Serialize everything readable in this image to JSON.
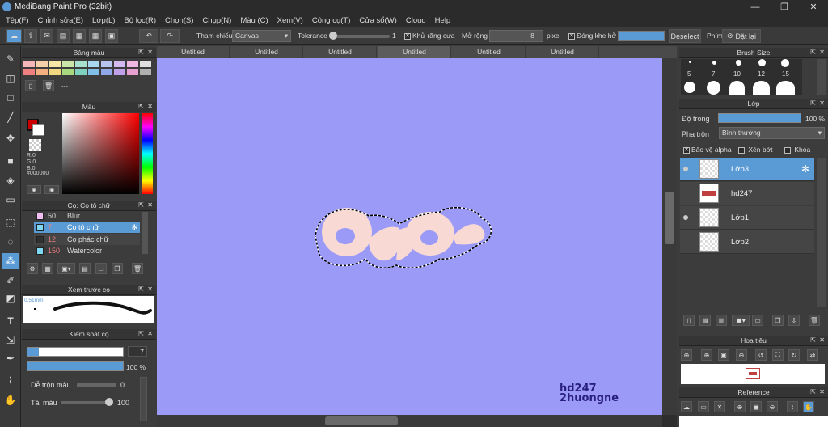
{
  "app": {
    "title": "MediBang Paint Pro (32bit)"
  },
  "window": {
    "minimize": "—",
    "maximize": "❐",
    "close": "✕"
  },
  "menu": [
    "Tệp(F)",
    "Chỉnh sửa(E)",
    "Lớp(L)",
    "Bộ lọc(R)",
    "Chọn(S)",
    "Chụp(N)",
    "Màu (C)",
    "Xem(V)",
    "Công cụ(T)",
    "Cửa sổ(W)",
    "Cloud",
    "Help"
  ],
  "toolbar": {
    "ref_label": "Tham chiếu",
    "ref_value": "Canvas",
    "tolerance_label": "Tolerance",
    "tolerance_value": "1",
    "antialias_label": "Khử răng cưa",
    "expand_label": "Mở rộng",
    "expand_value": "8",
    "pixel_label": "pixel",
    "close_gap_label": "Đóng khe hở",
    "deselect_label": "Deselect",
    "key_label": "Phím",
    "reset_label": "Đặt lại"
  },
  "tabs": [
    "Untitled",
    "Untitled",
    "Untitled",
    "Untitled",
    "Untitled",
    "Untitled"
  ],
  "palette": {
    "title": "Bảng màu",
    "name": "---",
    "swatches": [
      "#f4b6b6",
      "#f6d0a8",
      "#f7e8a8",
      "#c9e6a8",
      "#a8e0d0",
      "#a8d8f0",
      "#b8c4f0",
      "#d4b8f0",
      "#f0b8e0",
      "#e0e0e0",
      "#f08080",
      "#f4b080",
      "#f0d880",
      "#a8d880",
      "#80d0c0",
      "#80c0e8",
      "#90a8e8",
      "#c0a0e8",
      "#e8a0d0",
      "#b0b0b0"
    ]
  },
  "color": {
    "title": "Màu",
    "r": "R:0",
    "g": "G:0",
    "b": "B:0",
    "hex": "#000000",
    "main_color": "#cc0000"
  },
  "brush": {
    "title": "Cọ: Cọ tô chữ",
    "items": [
      {
        "size": "50",
        "name": "Blur",
        "color": "#f0c0f0"
      },
      {
        "size": "7",
        "name": "Cọ tô chữ",
        "color": "#80d8f0"
      },
      {
        "size": "12",
        "name": "Cọ phác chữ",
        "color": "#303030"
      },
      {
        "size": "150",
        "name": "Watercolor",
        "color": "#80d8f0"
      }
    ]
  },
  "preview": {
    "title": "Xem trước cọ",
    "size_label": "0.51mm"
  },
  "brush_control": {
    "title": "Kiểm soát cọ",
    "size_value": "7",
    "opacity_value": "100 %",
    "blend_label": "Dễ trộn màu",
    "blend_value": "0",
    "amount_label": "Tải màu",
    "amount_value": "100"
  },
  "brush_size": {
    "title": "Brush Size",
    "labels": [
      "5",
      "7",
      "10",
      "12",
      "15"
    ]
  },
  "layers": {
    "title": "Lớp",
    "opacity_label": "Độ trong",
    "opacity_value": "100 %",
    "blend_label": "Pha trộn",
    "blend_value": "Bình thường",
    "protect_alpha": "Bảo vệ alpha",
    "clipping": "Xén bớt",
    "lock": "Khóa",
    "items": [
      {
        "name": "Lớp3",
        "visible": true,
        "active": true
      },
      {
        "name": "hd247",
        "visible": false,
        "active": false
      },
      {
        "name": "Lớp1",
        "visible": true,
        "active": false
      },
      {
        "name": "Lớp2",
        "visible": false,
        "active": false
      }
    ]
  },
  "navigator": {
    "title": "Hoa tiêu"
  },
  "reference": {
    "title": "Reference"
  },
  "canvas": {
    "background": "#9b9bf7",
    "art_text": "owo",
    "watermark_line1": "hd247",
    "watermark_line2": "2huongne"
  },
  "icons": [
    "undo-icon",
    "redo-icon",
    "brush-icon",
    "eraser-icon",
    "fill-icon",
    "text-icon",
    "eyedropper-icon",
    "hand-icon",
    "gear-icon",
    "eye-icon",
    "close-icon"
  ]
}
